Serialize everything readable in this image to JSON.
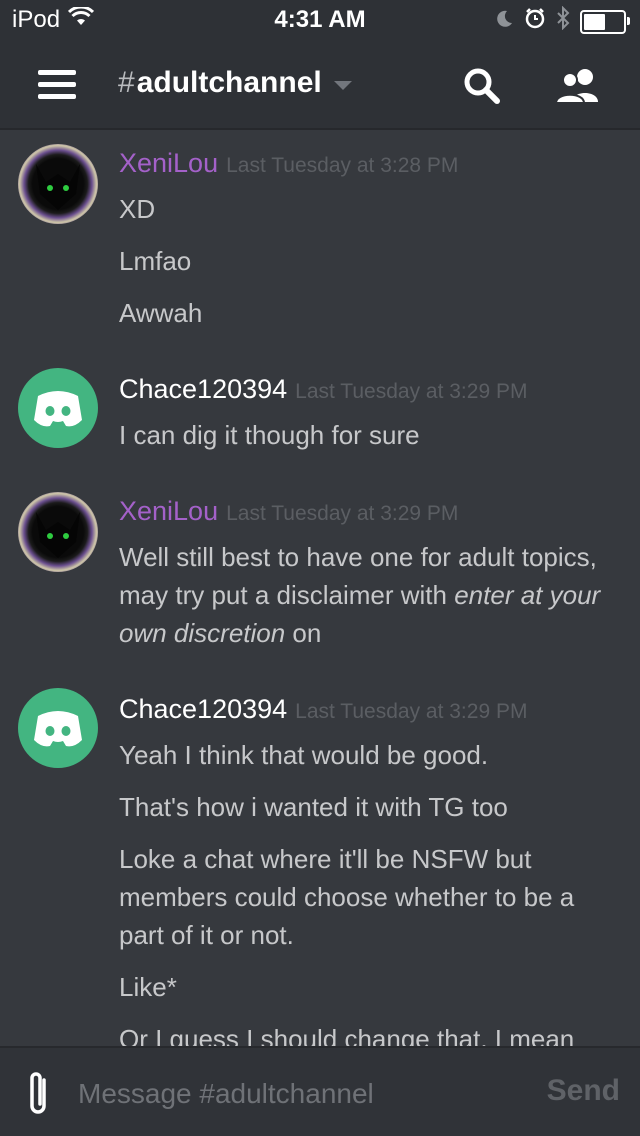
{
  "status_bar": {
    "carrier": "iPod",
    "time": "4:31 AM",
    "battery_level": 0.55
  },
  "header": {
    "hash": "#",
    "channel_name": "adultchannel"
  },
  "colors": {
    "xenilou_name": "#a461c9",
    "chace_name": "#ffffff",
    "discord_avatar": "#43b581"
  },
  "messages": [
    {
      "author": "XeniLou",
      "timestamp": "Last Tuesday at 3:28 PM",
      "lines": [
        "XD",
        "Lmfao",
        "Awwah"
      ]
    },
    {
      "author": "Chace120394",
      "timestamp": "Last Tuesday at 3:29 PM",
      "lines": [
        "I can dig it though for sure"
      ]
    },
    {
      "author": "XeniLou",
      "timestamp": "Last Tuesday at 3:29 PM",
      "lines": [
        "Well still best to have one for adult topics, may try put a disclaimer with",
        "enter at your own discretion",
        " on"
      ]
    },
    {
      "author": "Chace120394",
      "timestamp": "Last Tuesday at 3:29 PM",
      "lines": [
        "Yeah I think that would be good.",
        "That's how i wanted it with TG too",
        "Loke a chat where it'll be NSFW but members could choose whether to be a part of it or not.",
        "Like*",
        "Or I guess I should change that. I mean"
      ]
    }
  ],
  "composer": {
    "placeholder": "Message #adultchannel",
    "send_label": "Send"
  }
}
